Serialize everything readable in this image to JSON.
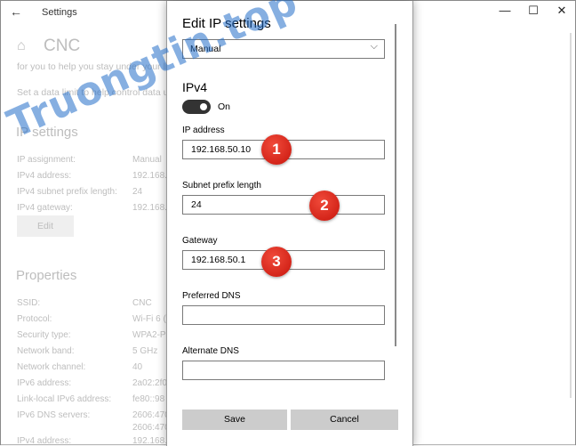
{
  "window": {
    "title": "Settings",
    "back_glyph": "←",
    "min_glyph": "—",
    "max_glyph": "☐",
    "close_glyph": "✕"
  },
  "background": {
    "home_glyph": "⌂",
    "page_title": "CNC",
    "line1": "for you to help you stay under your li",
    "line2": "Set a data limit to help control data us",
    "ip_settings_heading": "IP settings",
    "ip_rows": [
      {
        "label": "IP assignment:",
        "value": "Manual"
      },
      {
        "label": "IPv4 address:",
        "value": "192.168.5"
      },
      {
        "label": "IPv4 subnet prefix length:",
        "value": "24"
      },
      {
        "label": "IPv4 gateway:",
        "value": "192.168.5"
      }
    ],
    "edit_button": "Edit",
    "properties_heading": "Properties",
    "prop_rows": [
      {
        "label": "SSID:",
        "value": "CNC"
      },
      {
        "label": "Protocol:",
        "value": "Wi-Fi 6 ("
      },
      {
        "label": "Security type:",
        "value": "WPA2-Pe"
      },
      {
        "label": "Network band:",
        "value": "5 GHz"
      },
      {
        "label": "Network channel:",
        "value": "40"
      },
      {
        "label": "IPv6 address:",
        "value": "2a02:2f0"
      },
      {
        "label": "Link-local IPv6 address:",
        "value": "fe80::98"
      },
      {
        "label": "IPv6 DNS servers:",
        "value": "2606:470"
      },
      {
        "label": "",
        "value": "2606:470"
      },
      {
        "label": "IPv4 address:",
        "value": "192.168.5"
      }
    ]
  },
  "dialog": {
    "title": "Edit IP settings",
    "mode": "Manual",
    "chevron_glyph": "⌵",
    "ipv4_heading": "IPv4",
    "toggle_label": "On",
    "toggle_on": true,
    "fields": {
      "ip_address": {
        "label": "IP address",
        "value": "192.168.50.10"
      },
      "subnet": {
        "label": "Subnet prefix length",
        "value": "24"
      },
      "gateway": {
        "label": "Gateway",
        "value": "192.168.50.1"
      },
      "preferred_dns": {
        "label": "Preferred DNS",
        "value": ""
      },
      "alternate_dns": {
        "label": "Alternate DNS",
        "value": ""
      }
    },
    "save_label": "Save",
    "cancel_label": "Cancel"
  },
  "badges": [
    "1",
    "2",
    "3"
  ],
  "watermark": "Truongtin.top",
  "colors": {
    "badge_red": "#d42a1c",
    "watermark_blue": "#236ec8",
    "toggle_on": "#333333"
  }
}
